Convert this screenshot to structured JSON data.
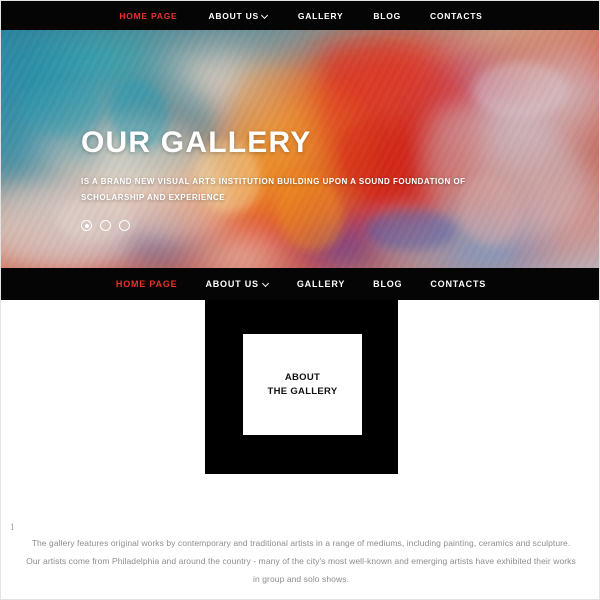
{
  "site": {
    "accent_color": "#e8322a",
    "dark_color": "#050505",
    "text_color": "#8d8d8d"
  },
  "top_nav": {
    "items": [
      {
        "label": "HOME PAGE",
        "active": true,
        "has_dropdown": false
      },
      {
        "label": "ABOUT US",
        "active": false,
        "has_dropdown": true
      },
      {
        "label": "GALLERY",
        "active": false,
        "has_dropdown": false
      },
      {
        "label": "BLOG",
        "active": false,
        "has_dropdown": false
      },
      {
        "label": "CONTACTS",
        "active": false,
        "has_dropdown": false
      }
    ]
  },
  "hero": {
    "title": "OUR GALLERY",
    "subtitle": "IS A BRAND NEW VISUAL ARTS INSTITUTION BUILDING UPON A SOUND FOUNDATION OF SCHOLARSHIP AND EXPERIENCE",
    "carousel": {
      "slide_count": 3,
      "active_index": 0
    }
  },
  "sub_nav": {
    "items": [
      {
        "label": "HOME PAGE",
        "active": true,
        "has_dropdown": false
      },
      {
        "label": "ABOUT US",
        "active": false,
        "has_dropdown": true
      },
      {
        "label": "GALLERY",
        "active": false,
        "has_dropdown": false
      },
      {
        "label": "BLOG",
        "active": false,
        "has_dropdown": false
      },
      {
        "label": "CONTACTS",
        "active": false,
        "has_dropdown": false
      }
    ]
  },
  "about": {
    "heading_line_1": "ABOUT",
    "heading_line_2": "THE GALLERY"
  },
  "content": {
    "marker": "1",
    "paragraph": "The gallery features original works by contemporary and traditional artists in a range of mediums, including painting, ceramics and sculpture. Our artists come from Philadelphia and around the country - many of the city's most well-known and emerging artists have exhibited their works in group and solo shows."
  }
}
